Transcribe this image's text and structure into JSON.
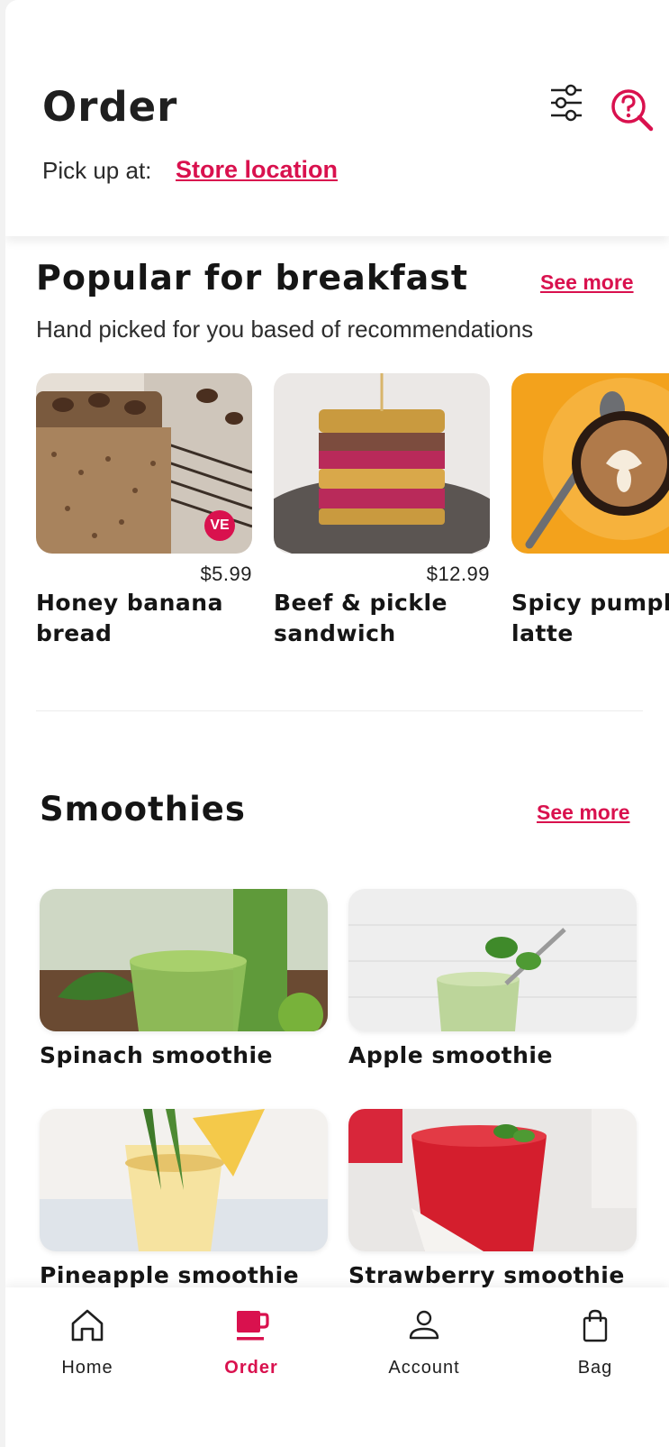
{
  "header": {
    "title": "Order",
    "pickup_label": "Pick up at:",
    "store_link": "Store location"
  },
  "popular": {
    "title": "Popular for breakfast",
    "see_more": "See more",
    "subtitle": "Hand picked for you based of recommendations",
    "items": [
      {
        "price": "$5.99",
        "name_line1": "Honey banana",
        "name_line2": "bread",
        "badge": "VE"
      },
      {
        "price": "$12.99",
        "name_line1": "Beef & pickle",
        "name_line2": "sandwich"
      },
      {
        "price": "$",
        "name_line1": "Spicy pumpk",
        "name_line2": "latte"
      }
    ]
  },
  "smoothies": {
    "title": "Smoothies",
    "see_more": "See more",
    "items": [
      {
        "name": "Spinach smoothie"
      },
      {
        "name": "Apple smoothie"
      },
      {
        "name": "Pineapple smoothie"
      },
      {
        "name": "Strawberry smoothie"
      }
    ]
  },
  "nav": {
    "items": [
      {
        "label": "Home",
        "icon": "home-icon"
      },
      {
        "label": "Order",
        "icon": "coffee-cup-icon",
        "active": true
      },
      {
        "label": "Account",
        "icon": "person-icon"
      },
      {
        "label": "Bag",
        "icon": "shopping-bag-icon"
      }
    ]
  },
  "colors": {
    "accent": "#d9114e",
    "text": "#151515",
    "background": "#ffffff"
  }
}
